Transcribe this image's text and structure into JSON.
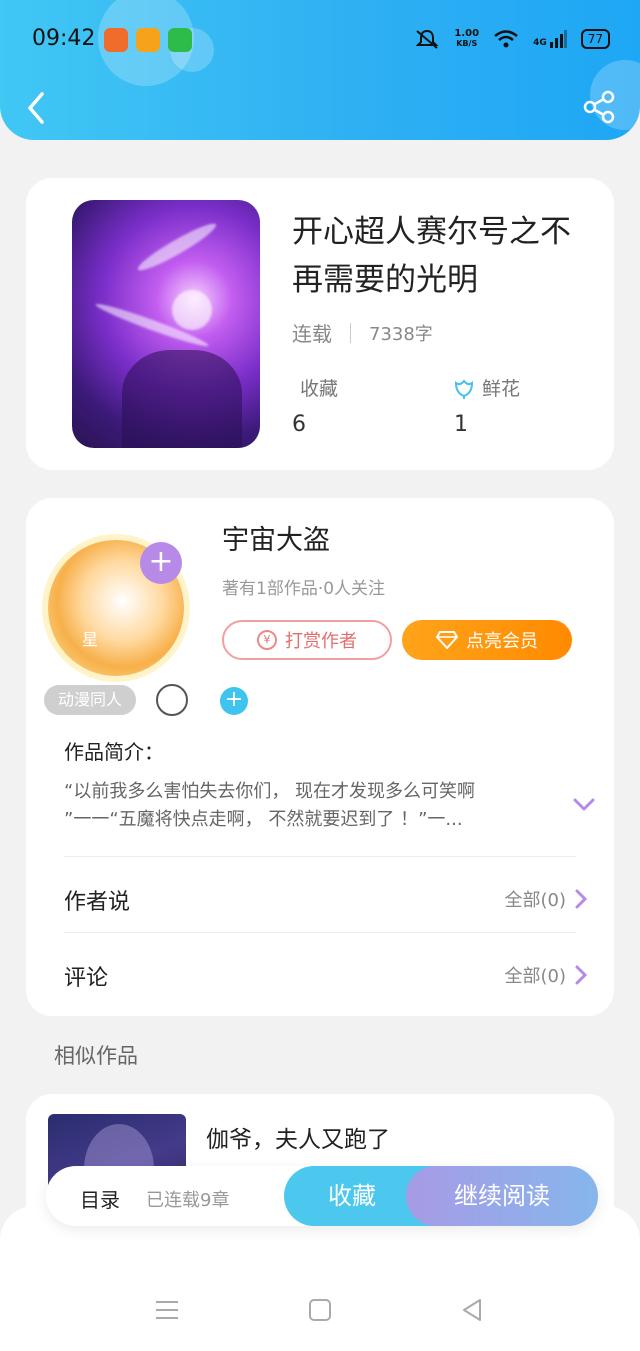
{
  "status_bar": {
    "time": "09:42",
    "speed_value": "1.00",
    "speed_unit": "KB/S",
    "network": "4G",
    "battery": "77"
  },
  "book": {
    "title": "开心超人赛尔号之不再需要的光明",
    "status": "连载",
    "word_count": "7338字",
    "stats": [
      {
        "label": "收藏",
        "value": "6"
      },
      {
        "label": "鲜花",
        "value": "1"
      }
    ]
  },
  "author": {
    "name": "宇宙大盗",
    "summary": "著有1部作品·0人关注",
    "reward_label": "打赏作者",
    "reward_coin": "¥",
    "vip_label": "点亮会员",
    "avatar_char": "星",
    "tag": "动漫同人"
  },
  "intro": {
    "title": "作品简介：",
    "line1": "“以前我多么害怕失去你们， 现在才发现多么可笑啊",
    "line2": "”一一“五魔将快点走啊， 不然就要迟到了 ！”一..."
  },
  "rows": {
    "author_says": {
      "label": "作者说",
      "link": "全部(0)"
    },
    "comments": {
      "label": "评论",
      "link": "全部(0)"
    }
  },
  "similar": {
    "section_title": "相似作品",
    "items": [
      {
        "title": "伽爷，夫人又跑了"
      }
    ]
  },
  "action_bar": {
    "toc": "目录",
    "chapters": "已连载9章",
    "favorite": "收藏",
    "continue": "继续阅读"
  },
  "colors": {
    "header": "#2fb0f3",
    "accent_vip": "#ff8a00",
    "purple": "#b88ae8"
  }
}
